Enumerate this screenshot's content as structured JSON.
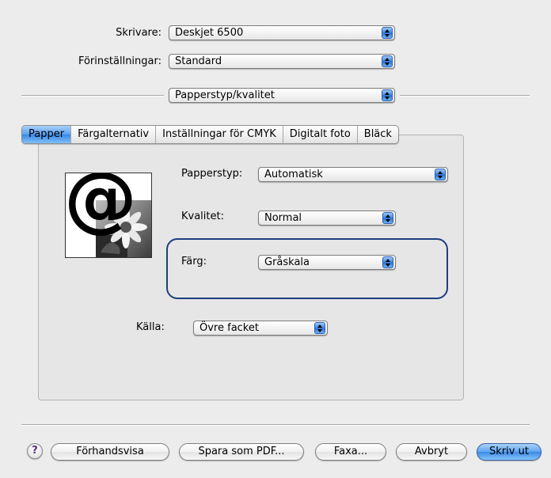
{
  "top": {
    "printer_label": "Skrivare:",
    "printer_value": "Deskjet 6500",
    "presets_label": "Förinställningar:",
    "presets_value": "Standard",
    "pane_value": "Papperstyp/kvalitet"
  },
  "tabs": [
    {
      "label": "Papper",
      "active": true
    },
    {
      "label": "Färgalternativ",
      "active": false
    },
    {
      "label": "Inställningar för CMYK",
      "active": false
    },
    {
      "label": "Digitalt foto",
      "active": false
    },
    {
      "label": "Bläck",
      "active": false
    }
  ],
  "panel": {
    "paper_type_label": "Papperstyp:",
    "paper_type_value": "Automatisk",
    "quality_label": "Kvalitet:",
    "quality_value": "Normal",
    "color_label": "Färg:",
    "color_value": "Gråskala",
    "source_label": "Källa:",
    "source_value": "Övre facket",
    "preview_glyph": "@"
  },
  "buttons": {
    "help": "?",
    "preview": "Förhandsvisa",
    "save_pdf": "Spara som PDF...",
    "fax": "Faxa...",
    "cancel": "Avbryt",
    "print": "Skriv ut"
  },
  "colors": {
    "accent": "#3a87e5",
    "highlight_border": "#1d3f80",
    "background": "#ececec"
  },
  "icons": {
    "help": "question-mark-icon",
    "popup_arrows": "up-down-arrows-icon"
  }
}
